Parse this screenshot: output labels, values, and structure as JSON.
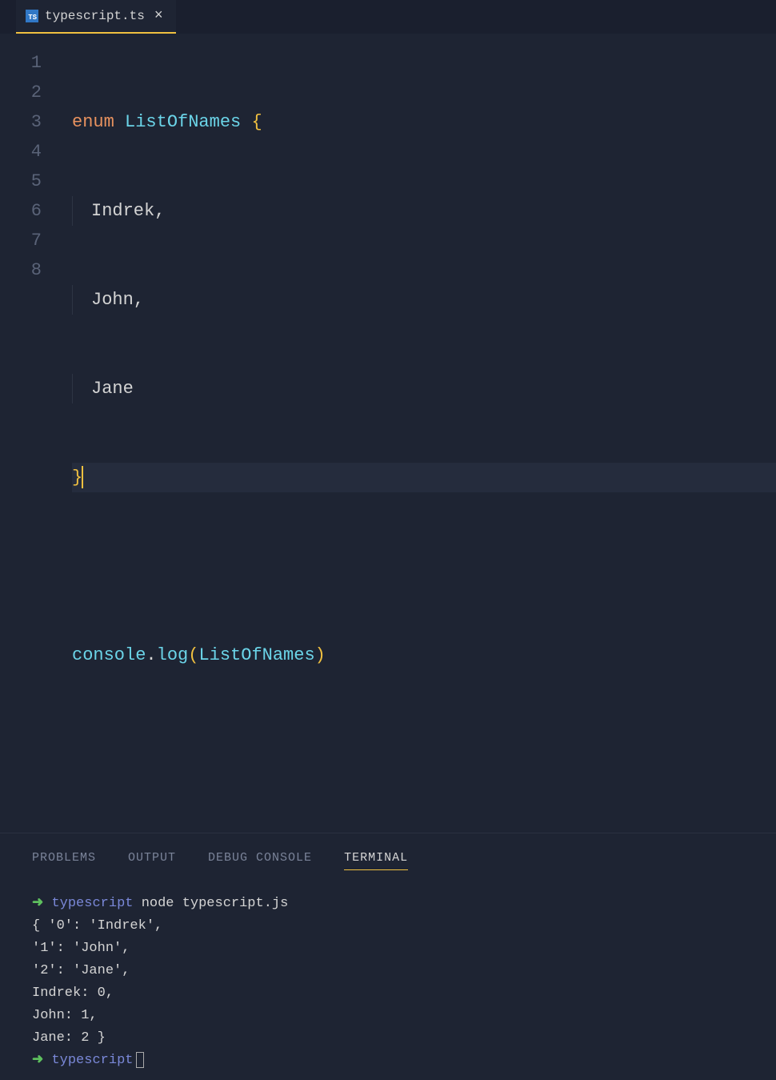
{
  "tab": {
    "filename": "typescript.ts",
    "icon_text": "TS"
  },
  "editor": {
    "line_numbers": [
      "1",
      "2",
      "3",
      "4",
      "5",
      "6",
      "7",
      "8"
    ],
    "code": {
      "enum_kw": "enum",
      "type_name": "ListOfNames",
      "open_brace": "{",
      "member1": "Indrek",
      "member2": "John",
      "member3": "Jane",
      "comma": ",",
      "close_brace": "}",
      "console": "console",
      "log": "log",
      "open_paren": "(",
      "close_paren": ")",
      "arg": "ListOfNames"
    }
  },
  "panel": {
    "tabs": {
      "problems": "PROBLEMS",
      "output": "OUTPUT",
      "debug": "DEBUG CONSOLE",
      "terminal": "TERMINAL"
    }
  },
  "terminal": {
    "arrow": "➜",
    "dir": "typescript",
    "cmd": "node typescript.js",
    "out1": "{ '0': 'Indrek',",
    "out2": "  '1': 'John',",
    "out3": "  '2': 'Jane',",
    "out4": "  Indrek: 0,",
    "out5": "  John: 1,",
    "out6": "  Jane: 2 }"
  }
}
